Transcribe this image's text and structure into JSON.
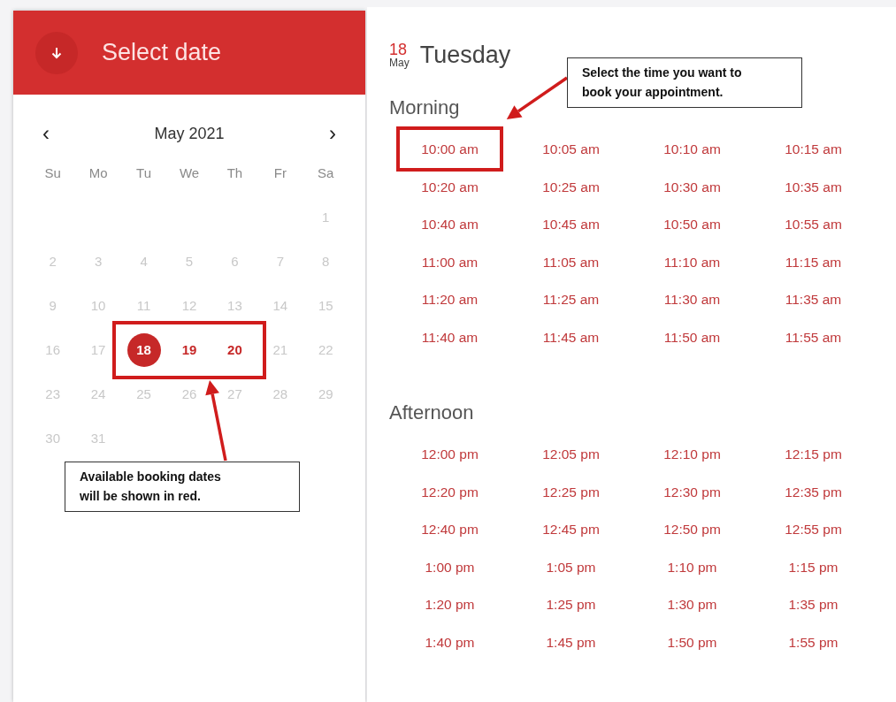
{
  "header": {
    "title": "Select date"
  },
  "calendar": {
    "month": "May 2021",
    "prev": "‹",
    "next": "›",
    "weekdays": [
      "Su",
      "Mo",
      "Tu",
      "We",
      "Th",
      "Fr",
      "Sa"
    ],
    "days": [
      {
        "label": "1",
        "available": false,
        "selected": false
      },
      {
        "label": "2",
        "available": false,
        "selected": false
      },
      {
        "label": "3",
        "available": false,
        "selected": false
      },
      {
        "label": "4",
        "available": false,
        "selected": false
      },
      {
        "label": "5",
        "available": false,
        "selected": false
      },
      {
        "label": "6",
        "available": false,
        "selected": false
      },
      {
        "label": "7",
        "available": false,
        "selected": false
      },
      {
        "label": "8",
        "available": false,
        "selected": false
      },
      {
        "label": "9",
        "available": false,
        "selected": false
      },
      {
        "label": "10",
        "available": false,
        "selected": false
      },
      {
        "label": "11",
        "available": false,
        "selected": false
      },
      {
        "label": "12",
        "available": false,
        "selected": false
      },
      {
        "label": "13",
        "available": false,
        "selected": false
      },
      {
        "label": "14",
        "available": false,
        "selected": false
      },
      {
        "label": "15",
        "available": false,
        "selected": false
      },
      {
        "label": "16",
        "available": false,
        "selected": false
      },
      {
        "label": "17",
        "available": false,
        "selected": false
      },
      {
        "label": "18",
        "available": true,
        "selected": true
      },
      {
        "label": "19",
        "available": true,
        "selected": false
      },
      {
        "label": "20",
        "available": true,
        "selected": false
      },
      {
        "label": "21",
        "available": false,
        "selected": false
      },
      {
        "label": "22",
        "available": false,
        "selected": false
      },
      {
        "label": "23",
        "available": false,
        "selected": false
      },
      {
        "label": "24",
        "available": false,
        "selected": false
      },
      {
        "label": "25",
        "available": false,
        "selected": false
      },
      {
        "label": "26",
        "available": false,
        "selected": false
      },
      {
        "label": "27",
        "available": false,
        "selected": false
      },
      {
        "label": "28",
        "available": false,
        "selected": false
      },
      {
        "label": "29",
        "available": false,
        "selected": false
      },
      {
        "label": "30",
        "available": false,
        "selected": false
      },
      {
        "label": "31",
        "available": false,
        "selected": false
      }
    ]
  },
  "day_header": {
    "day": "18",
    "month": "May",
    "weekday": "Tuesday"
  },
  "sections": [
    {
      "title": "Morning",
      "slots": [
        {
          "label": "10:00 am",
          "highlighted": true
        },
        {
          "label": "10:05 am",
          "highlighted": false
        },
        {
          "label": "10:10 am",
          "highlighted": false
        },
        {
          "label": "10:15 am",
          "highlighted": false
        },
        {
          "label": "10:20 am",
          "highlighted": false
        },
        {
          "label": "10:25 am",
          "highlighted": false
        },
        {
          "label": "10:30 am",
          "highlighted": false
        },
        {
          "label": "10:35 am",
          "highlighted": false
        },
        {
          "label": "10:40 am",
          "highlighted": false
        },
        {
          "label": "10:45 am",
          "highlighted": false
        },
        {
          "label": "10:50 am",
          "highlighted": false
        },
        {
          "label": "10:55 am",
          "highlighted": false
        },
        {
          "label": "11:00 am",
          "highlighted": false
        },
        {
          "label": "11:05 am",
          "highlighted": false
        },
        {
          "label": "11:10 am",
          "highlighted": false
        },
        {
          "label": "11:15 am",
          "highlighted": false
        },
        {
          "label": "11:20 am",
          "highlighted": false
        },
        {
          "label": "11:25 am",
          "highlighted": false
        },
        {
          "label": "11:30 am",
          "highlighted": false
        },
        {
          "label": "11:35 am",
          "highlighted": false
        },
        {
          "label": "11:40 am",
          "highlighted": false
        },
        {
          "label": "11:45 am",
          "highlighted": false
        },
        {
          "label": "11:50 am",
          "highlighted": false
        },
        {
          "label": "11:55 am",
          "highlighted": false
        }
      ]
    },
    {
      "title": "Afternoon",
      "slots": [
        {
          "label": "12:00 pm",
          "highlighted": false
        },
        {
          "label": "12:05 pm",
          "highlighted": false
        },
        {
          "label": "12:10 pm",
          "highlighted": false
        },
        {
          "label": "12:15 pm",
          "highlighted": false
        },
        {
          "label": "12:20 pm",
          "highlighted": false
        },
        {
          "label": "12:25 pm",
          "highlighted": false
        },
        {
          "label": "12:30 pm",
          "highlighted": false
        },
        {
          "label": "12:35 pm",
          "highlighted": false
        },
        {
          "label": "12:40 pm",
          "highlighted": false
        },
        {
          "label": "12:45 pm",
          "highlighted": false
        },
        {
          "label": "12:50 pm",
          "highlighted": false
        },
        {
          "label": "12:55 pm",
          "highlighted": false
        },
        {
          "label": "1:00 pm",
          "highlighted": false
        },
        {
          "label": "1:05 pm",
          "highlighted": false
        },
        {
          "label": "1:10 pm",
          "highlighted": false
        },
        {
          "label": "1:15 pm",
          "highlighted": false
        },
        {
          "label": "1:20 pm",
          "highlighted": false
        },
        {
          "label": "1:25 pm",
          "highlighted": false
        },
        {
          "label": "1:30 pm",
          "highlighted": false
        },
        {
          "label": "1:35 pm",
          "highlighted": false
        },
        {
          "label": "1:40 pm",
          "highlighted": false
        },
        {
          "label": "1:45 pm",
          "highlighted": false
        },
        {
          "label": "1:50 pm",
          "highlighted": false
        },
        {
          "label": "1:55 pm",
          "highlighted": false
        }
      ]
    }
  ],
  "annotations": [
    {
      "kind": "dates",
      "text": "Available booking dates will be shown in red."
    },
    {
      "kind": "time",
      "text": "Select the time you want to book your appointment."
    }
  ]
}
